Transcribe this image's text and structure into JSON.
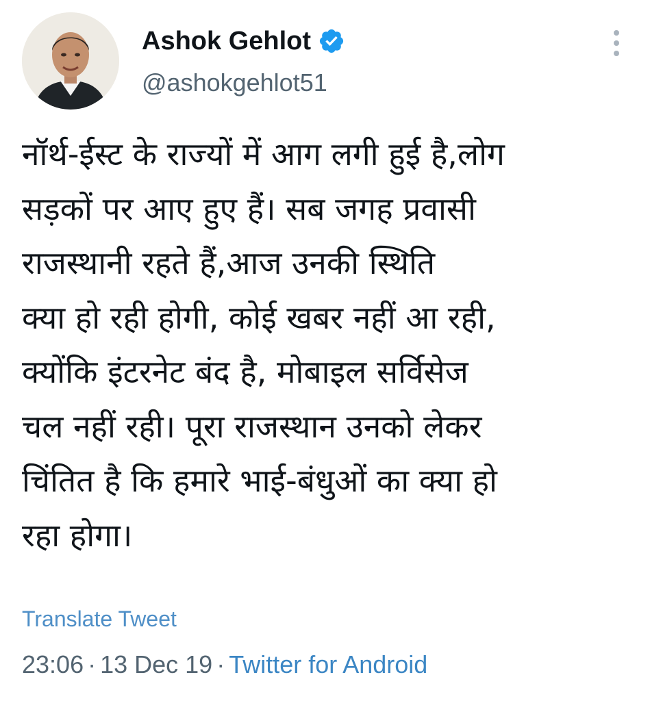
{
  "author": {
    "display_name": "Ashok Gehlot",
    "handle": "@ashokgehlot51",
    "verified": true,
    "verified_icon": "verified-badge-icon",
    "avatar_icon": "profile-photo"
  },
  "tweet": {
    "lines": [
      "नॉर्थ-ईस्ट के राज्यों में आग लगी हुई है,लोग",
      "सड़कों पर आए हुए हैं। सब जगह प्रवासी",
      "राजस्थानी रहते हैं,आज उनकी स्थिति",
      "क्या हो रही होगी, कोई खबर नहीं आ रही,",
      "क्योंकि इंटरनेट बंद है, मोबाइल सर्विसेज",
      "चल नहीं रही। पूरा राजस्थान उनको लेकर",
      "चिंतित है कि हमारे भाई-बंधुओं का क्या हो",
      "रहा होगा।"
    ]
  },
  "translate_label": "Translate Tweet",
  "meta": {
    "time": "23:06",
    "separator": "·",
    "date": "13 Dec 19",
    "source": "Twitter for Android"
  },
  "more_icon": "more-vertical-icon",
  "colors": {
    "text": "#0f1419",
    "secondary": "#536471",
    "link": "#3b86c4",
    "verified": "#1d9bf0"
  }
}
